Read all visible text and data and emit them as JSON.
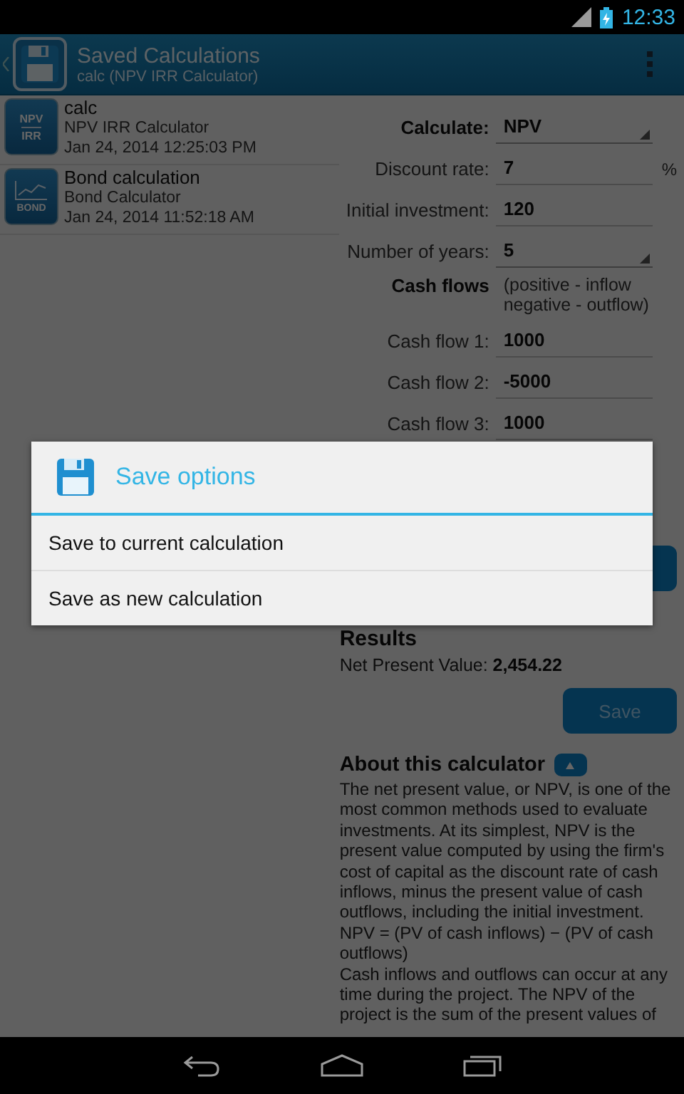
{
  "status_bar": {
    "time": "12:33"
  },
  "action_bar": {
    "title": "Saved Calculations",
    "subtitle": "calc (NPV IRR Calculator)"
  },
  "saved_list": [
    {
      "kind": "npv",
      "icon_text": [
        "NPV",
        "IRR"
      ],
      "name": "calc",
      "calculator": "NPV IRR Calculator",
      "date": "Jan 24, 2014 12:25:03 PM"
    },
    {
      "kind": "bond",
      "icon_text": [
        "BOND"
      ],
      "name": "Bond calculation",
      "calculator": "Bond Calculator",
      "date": "Jan 24, 2014 11:52:18 AM"
    }
  ],
  "form": {
    "fields": [
      {
        "kind": "select",
        "label": "Calculate:",
        "bold": true,
        "value": "NPV"
      },
      {
        "kind": "input",
        "label": "Discount rate:",
        "bold": false,
        "value": "7",
        "unit": "%"
      },
      {
        "kind": "input",
        "label": "Initial investment:",
        "bold": false,
        "value": "120"
      },
      {
        "kind": "select",
        "label": "Number of years:",
        "bold": false,
        "value": "5"
      }
    ],
    "cash_flows": {
      "label": "Cash flows",
      "note": "(positive - inflow negative - outflow)"
    },
    "cash_flow_rows": [
      {
        "label": "Cash flow 1:",
        "value": "1000"
      },
      {
        "label": "Cash flow 2:",
        "value": "-5000"
      },
      {
        "label": "Cash flow 3:",
        "value": "1000"
      }
    ]
  },
  "results": {
    "heading": "Results",
    "line": "Net Present Value: **2,454.22**"
  },
  "save_button": "Save",
  "about": {
    "title": "About this calculator",
    "expanded": true,
    "paragraphs": [
      "The net present value, or NPV, is one of the most common methods used to evaluate investments. At its simplest, NPV is the present value computed by using the firm's cost of capital as the discount rate of cash inflows, minus the present value of cash outflows, including the initial investment.",
      "NPV = (PV of cash inflows) − (PV of cash outflows)",
      "Cash inflows and outflows can occur at any time during the project. The NPV of the project is the sum of the present values of"
    ]
  },
  "dialog": {
    "title": "Save options",
    "options": [
      {
        "label": "Save to current calculation"
      },
      {
        "label": "Save as new calculation"
      }
    ]
  }
}
